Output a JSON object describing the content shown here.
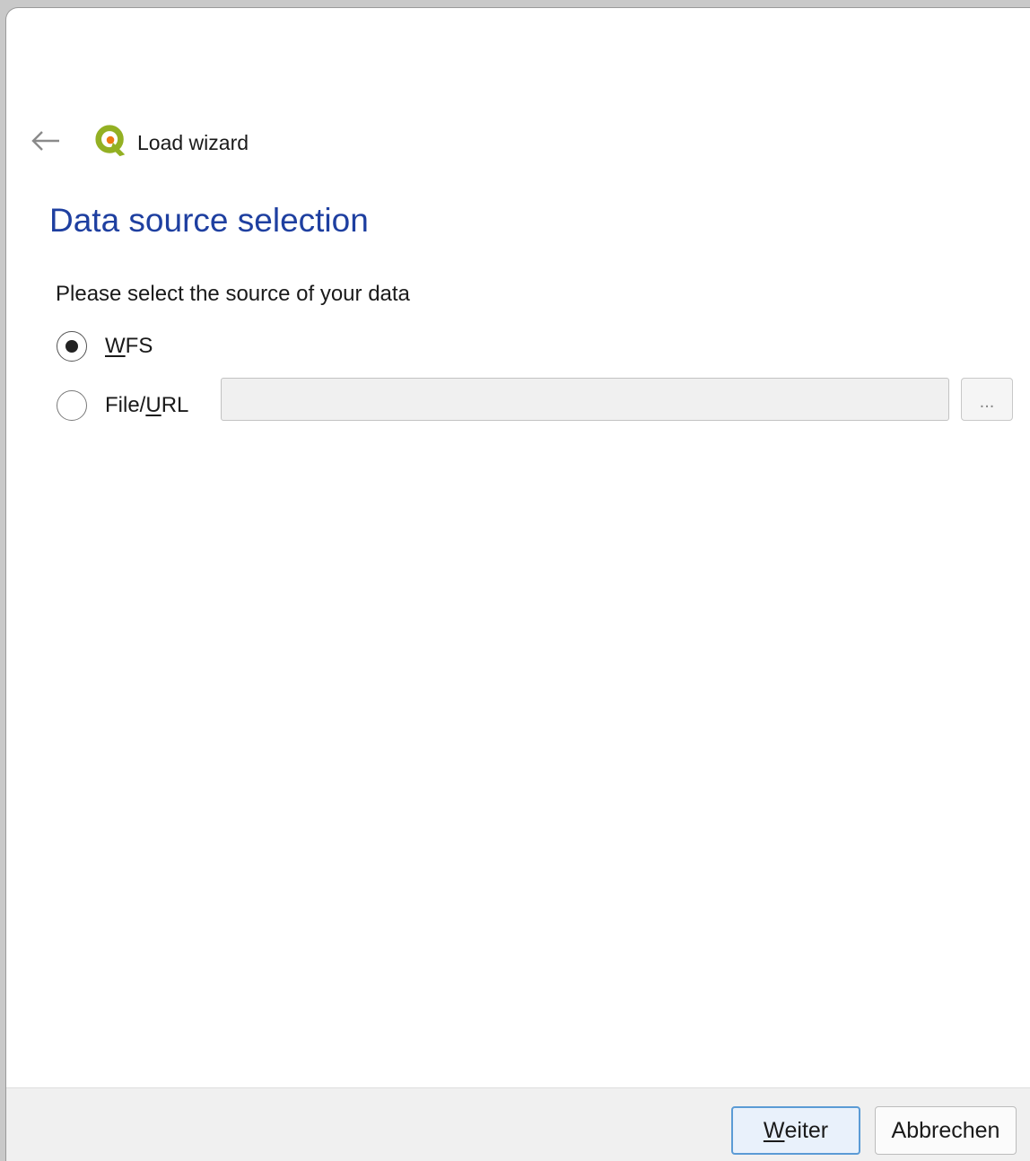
{
  "window": {
    "title": "Load wizard"
  },
  "nav": {
    "back_icon": "arrow-left-icon",
    "app_icon": "qgis-logo-icon"
  },
  "page": {
    "title": "Data source selection",
    "prompt": "Please select the source of your data"
  },
  "source_options": {
    "wfs": {
      "label_mnemonic": "W",
      "label_rest": "FS",
      "selected": true
    },
    "file_url": {
      "label_before": "File/",
      "label_mnemonic": "U",
      "label_after": "RL",
      "selected": false,
      "value": "",
      "browse_label": "..."
    }
  },
  "footer": {
    "next": {
      "mnemonic": "W",
      "rest": "eiter"
    },
    "cancel_label": "Abbrechen"
  },
  "colors": {
    "title_blue": "#1e3fa0",
    "default_button_border": "#5b9bd5",
    "footer_bg": "#f0f0f0",
    "qgis_green": "#93b023",
    "qgis_orange": "#ee7913"
  }
}
